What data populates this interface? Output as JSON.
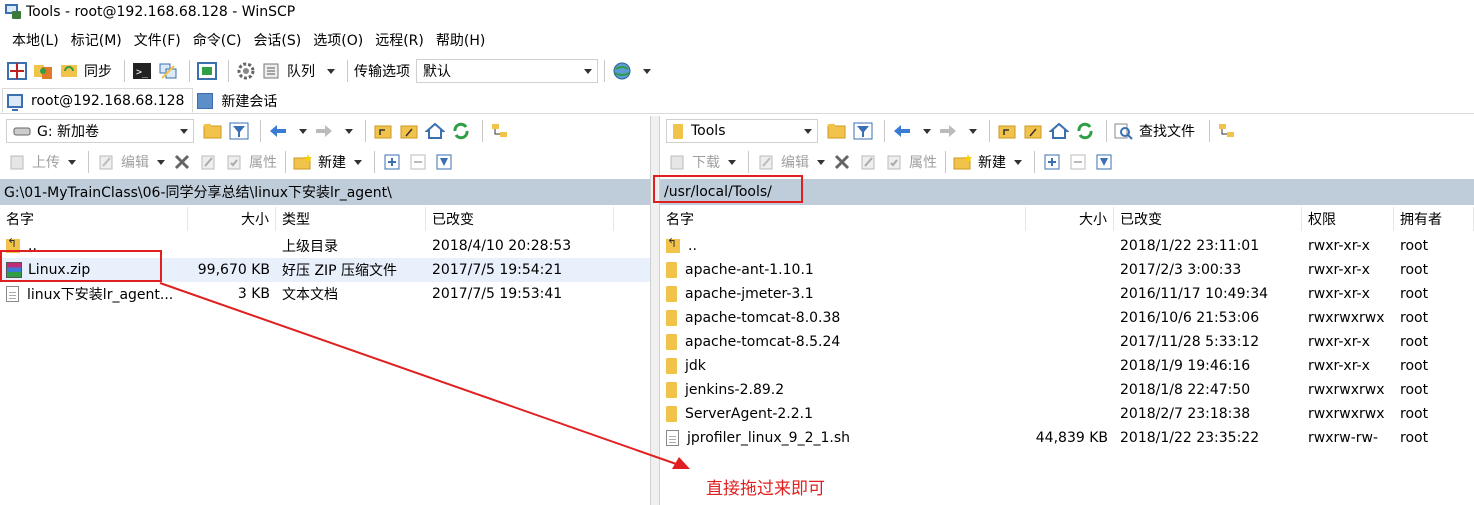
{
  "window": {
    "title": "Tools - root@192.168.68.128 - WinSCP"
  },
  "menu": [
    "本地(L)",
    "标记(M)",
    "文件(F)",
    "命令(C)",
    "会话(S)",
    "选项(O)",
    "远程(R)",
    "帮助(H)"
  ],
  "toolbar": {
    "sync_label": "同步",
    "queue_label": "队列",
    "transfer_label": "传输选项",
    "transfer_value": "默认"
  },
  "sessions": [
    {
      "label": "root@192.168.68.128"
    },
    {
      "label": "新建会话"
    }
  ],
  "left": {
    "drive": "G: 新加卷",
    "upload_label": "上传",
    "edit_label": "编辑",
    "props_label": "属性",
    "new_label": "新建",
    "path": "G:\\01-MyTrainClass\\06-同学分享总结\\linux下安装lr_agent\\",
    "columns": {
      "name": "名字",
      "size": "大小",
      "type": "类型",
      "changed": "已改变"
    },
    "rows": [
      {
        "name": "..",
        "size": "",
        "type": "上级目录",
        "changed": "2018/4/10  20:28:53",
        "icon": "up-folder-icon"
      },
      {
        "name": "Linux.zip",
        "size": "99,670 KB",
        "type": "好压 ZIP 压缩文件",
        "changed": "2017/7/5  19:54:21",
        "icon": "zip-icon"
      },
      {
        "name": "linux下安装lr_agent...",
        "size": "3 KB",
        "type": "文本文档",
        "changed": "2017/7/5  19:53:41",
        "icon": "text-file-icon"
      }
    ]
  },
  "right": {
    "dir": "Tools",
    "find_label": "查找文件",
    "download_label": "下载",
    "edit_label": "编辑",
    "props_label": "属性",
    "new_label": "新建",
    "path": "/usr/local/Tools/",
    "columns": {
      "name": "名字",
      "size": "大小",
      "changed": "已改变",
      "rights": "权限",
      "owner": "拥有者"
    },
    "rows": [
      {
        "name": "..",
        "size": "",
        "changed": "2018/1/22 23:11:01",
        "rights": "rwxr-xr-x",
        "owner": "root",
        "icon": "up-folder-icon"
      },
      {
        "name": "apache-ant-1.10.1",
        "size": "",
        "changed": "2017/2/3 3:00:33",
        "rights": "rwxr-xr-x",
        "owner": "root",
        "icon": "folder-icon"
      },
      {
        "name": "apache-jmeter-3.1",
        "size": "",
        "changed": "2016/11/17 10:49:34",
        "rights": "rwxr-xr-x",
        "owner": "root",
        "icon": "folder-icon"
      },
      {
        "name": "apache-tomcat-8.0.38",
        "size": "",
        "changed": "2016/10/6 21:53:06",
        "rights": "rwxrwxrwx",
        "owner": "root",
        "icon": "folder-icon"
      },
      {
        "name": "apache-tomcat-8.5.24",
        "size": "",
        "changed": "2017/11/28 5:33:12",
        "rights": "rwxr-xr-x",
        "owner": "root",
        "icon": "folder-icon"
      },
      {
        "name": "jdk",
        "size": "",
        "changed": "2018/1/9 19:46:16",
        "rights": "rwxr-xr-x",
        "owner": "root",
        "icon": "folder-icon"
      },
      {
        "name": "jenkins-2.89.2",
        "size": "",
        "changed": "2018/1/8 22:47:50",
        "rights": "rwxrwxrwx",
        "owner": "root",
        "icon": "folder-icon"
      },
      {
        "name": "ServerAgent-2.2.1",
        "size": "",
        "changed": "2018/2/7 23:18:38",
        "rights": "rwxrwxrwx",
        "owner": "root",
        "icon": "folder-icon"
      },
      {
        "name": "jprofiler_linux_9_2_1.sh",
        "size": "44,839 KB",
        "changed": "2018/1/22 23:35:22",
        "rights": "rwxrw-rw-",
        "owner": "root",
        "icon": "text-file-icon"
      }
    ]
  },
  "annotation": "直接拖过来即可",
  "colors": {
    "path_bar": "#bfcddb",
    "highlight": "#e02020",
    "folder": "#f2c34a"
  }
}
